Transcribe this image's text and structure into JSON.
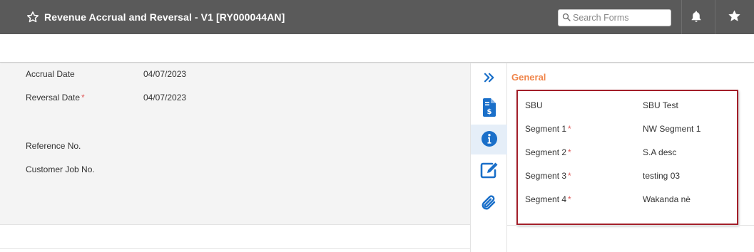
{
  "header": {
    "title": "Revenue Accrual and Reversal - V1 [RY000044AN]",
    "search_placeholder": "Search Forms",
    "bg_color": "#5a5a5a"
  },
  "form": {
    "fields": [
      {
        "label": "Accrual Date",
        "value": "04/07/2023",
        "required": false
      },
      {
        "label": "Reversal Date",
        "value": "04/07/2023",
        "required": true
      },
      {
        "label": "Reference No.",
        "value": "",
        "required": false
      },
      {
        "label": "Customer Job No.",
        "value": "",
        "required": false
      }
    ]
  },
  "rail": {
    "icons": [
      "double-chevron-right-icon",
      "invoice-dollar-icon",
      "info-icon",
      "edit-icon",
      "paperclip-icon"
    ],
    "accent": "#1a6fc9"
  },
  "general": {
    "title": "General",
    "title_color": "#f0854a",
    "border_color": "#a31f2a",
    "fields": [
      {
        "label": "SBU",
        "value": "SBU Test",
        "required": false
      },
      {
        "label": "Segment 1",
        "value": "NW Segment 1",
        "required": true
      },
      {
        "label": "Segment 2",
        "value": "S.A desc",
        "required": true
      },
      {
        "label": "Segment 3",
        "value": "testing 03",
        "required": true
      },
      {
        "label": "Segment 4",
        "value": "Wakanda nè",
        "required": true
      }
    ]
  },
  "required_marker": "*",
  "required_color": "#e05a5a"
}
